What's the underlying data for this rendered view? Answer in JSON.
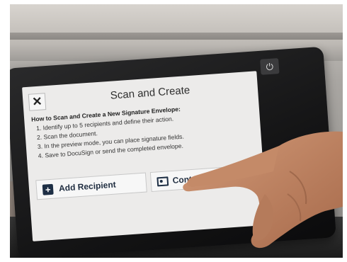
{
  "screen": {
    "title": "Scan and Create",
    "close_symbol": "✕",
    "instructions": {
      "heading": "How to Scan and Create a New Signature Envelope:",
      "steps": [
        "1. Identify up to 5 recipients and define their action.",
        "2. Scan the document.",
        "3. In the preview mode, you can place signature fields.",
        "4. Save to DocuSign or send the completed envelope."
      ]
    },
    "buttons": {
      "add_recipient": "Add Recipient",
      "contacts": "Contacts"
    }
  },
  "icons": {
    "close": "close-icon",
    "add": "plus-icon",
    "contacts": "contacts-icon",
    "power": "power-icon"
  },
  "colors": {
    "screen_bg": "#ecebea",
    "bezel": "#151516",
    "button_icon": "#1e2f45",
    "skin": "#b77a5a"
  }
}
